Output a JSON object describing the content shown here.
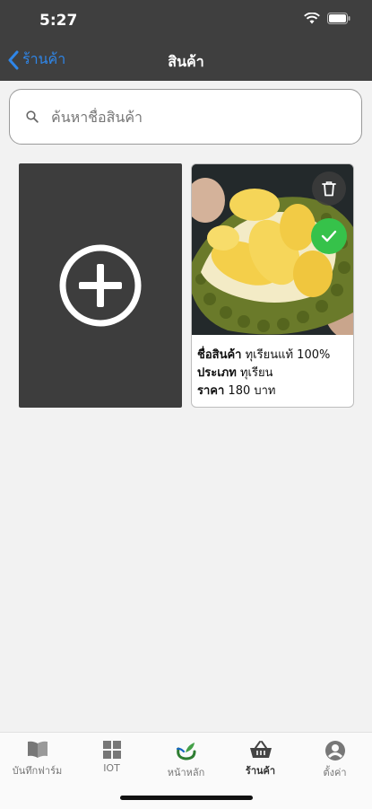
{
  "status": {
    "time": "5:27"
  },
  "nav": {
    "back_label": "ร้านค้า",
    "title": "สินค้า"
  },
  "search": {
    "placeholder": "ค้นหาชื่อสินค้า"
  },
  "product": {
    "name_label": "ชื่อสินค้า",
    "name_value": "ทุเรียนแท้ 100%",
    "type_label": "ประเภท",
    "type_value": "ทุเรียน",
    "price_label": "ราคา",
    "price_value": "180 บาท",
    "selected": true
  },
  "tabs": [
    {
      "label": "บันทึกฟาร์ม",
      "icon": "book-icon"
    },
    {
      "label": "IOT",
      "icon": "grid-icon"
    },
    {
      "label": "หน้าหลัก",
      "icon": "home-logo-icon"
    },
    {
      "label": "ร้านค้า",
      "icon": "basket-icon",
      "active": true
    },
    {
      "label": "ตั้งค่า",
      "icon": "user-icon"
    }
  ],
  "colors": {
    "header": "#3f3f3f",
    "accent": "#2f86e8",
    "check": "#36c24a"
  }
}
